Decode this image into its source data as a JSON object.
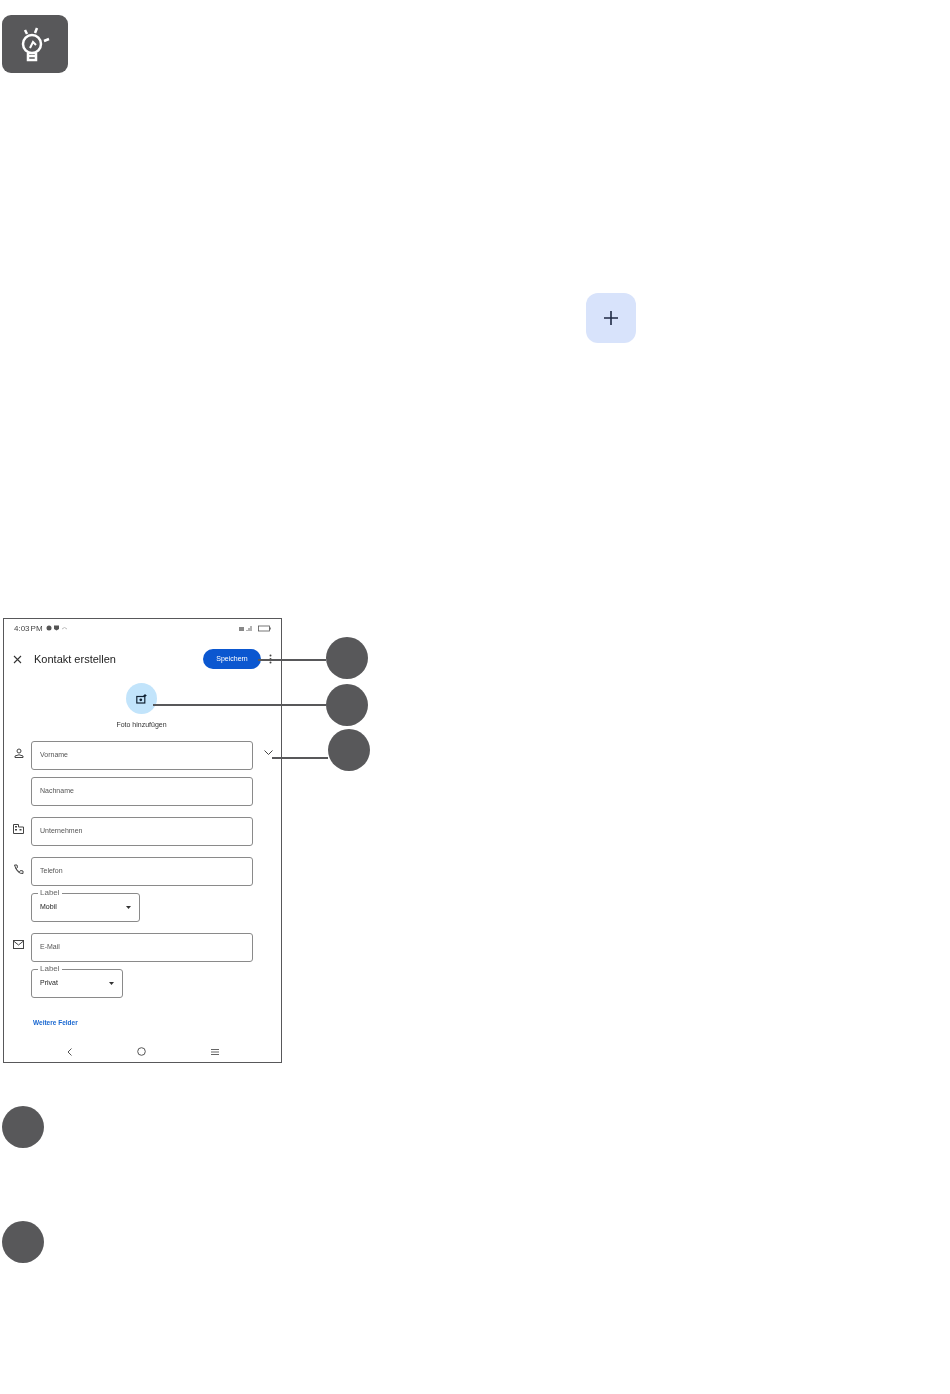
{
  "screen": {
    "status_bar": {
      "time": "4:03",
      "meridiem": "PM"
    },
    "app_bar": {
      "title": "Kontakt erstellen",
      "save_button": "Speichern"
    },
    "photo": {
      "label": "Foto hinzufügen"
    },
    "field_groups": [
      {
        "fields": [
          {
            "kind": "text",
            "placeholder": "Vorname"
          },
          {
            "kind": "text",
            "placeholder": "Nachname"
          }
        ]
      },
      {
        "fields": [
          {
            "kind": "text",
            "placeholder": "Unternehmen"
          }
        ]
      },
      {
        "fields": [
          {
            "kind": "text",
            "placeholder": "Telefon"
          },
          {
            "kind": "dropdown",
            "label": "Label",
            "value": "Mobil"
          }
        ]
      },
      {
        "fields": [
          {
            "kind": "text",
            "placeholder": "E-Mail"
          },
          {
            "kind": "dropdown",
            "label": "Label",
            "value": "Privat"
          }
        ]
      }
    ],
    "more_fields_link": "Weitere Felder"
  }
}
